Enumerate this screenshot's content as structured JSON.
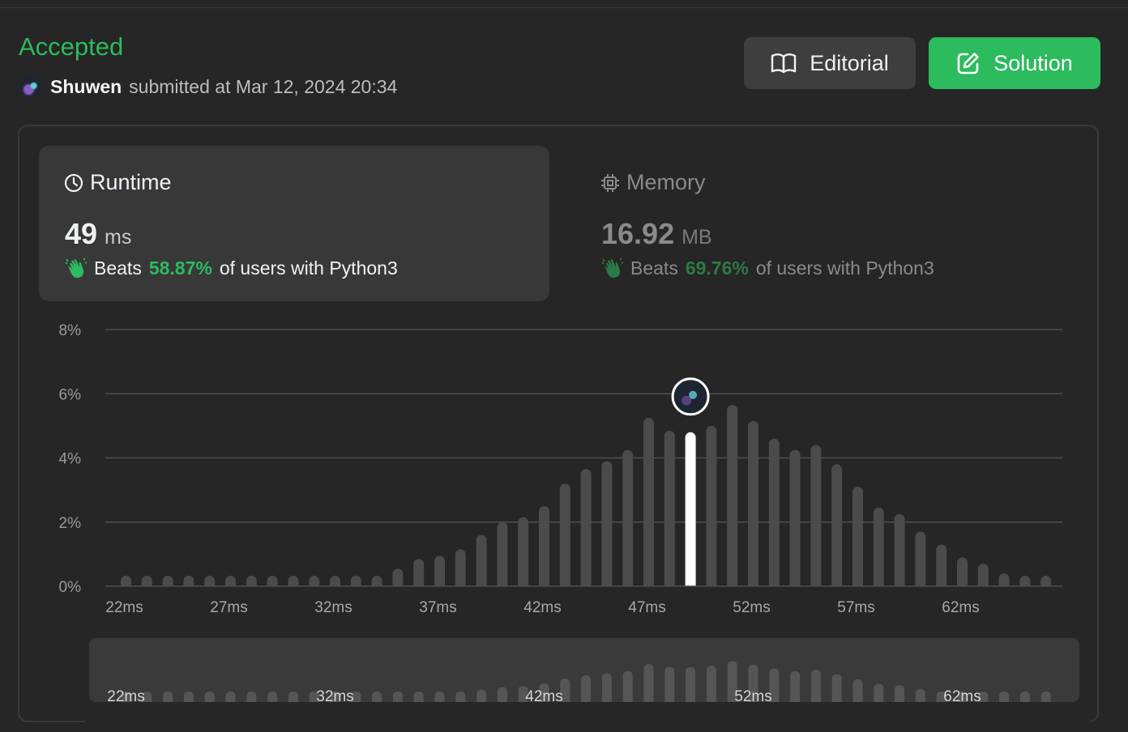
{
  "submission": {
    "status": "Accepted",
    "username": "Shuwen",
    "submitted_text": "submitted at Mar 12, 2024 20:34"
  },
  "buttons": {
    "editorial_label": "Editorial",
    "solution_label": "Solution"
  },
  "runtime": {
    "title": "Runtime",
    "value": "49",
    "unit": "ms",
    "beats_label": "Beats",
    "beats_pct": "58.87%",
    "beats_suffix": "of users with Python3"
  },
  "memory": {
    "title": "Memory",
    "value": "16.92",
    "unit": "MB",
    "beats_label": "Beats",
    "beats_pct": "69.76%",
    "beats_suffix": "of users with Python3"
  },
  "colors": {
    "accent": "#2cbb5d",
    "background": "#262626",
    "card": "#383838",
    "bar": "#4b4b4b",
    "highlight_bar": "#ffffff"
  },
  "chart_data": {
    "type": "bar",
    "x": [
      22,
      23,
      24,
      25,
      26,
      27,
      28,
      29,
      30,
      31,
      32,
      33,
      34,
      35,
      36,
      37,
      38,
      39,
      40,
      41,
      42,
      43,
      44,
      45,
      46,
      47,
      48,
      49,
      50,
      51,
      52,
      53,
      54,
      55,
      56,
      57,
      58,
      59,
      60,
      61,
      62,
      63,
      64,
      65,
      66
    ],
    "values": [
      0.08,
      0.08,
      0.08,
      0.08,
      0.08,
      0.08,
      0.08,
      0.08,
      0.08,
      0.08,
      0.12,
      0.2,
      0.3,
      0.55,
      0.85,
      0.95,
      1.15,
      1.6,
      2.0,
      2.15,
      2.5,
      3.2,
      3.65,
      3.9,
      4.25,
      5.25,
      4.85,
      4.8,
      5.0,
      5.65,
      5.15,
      4.6,
      4.25,
      4.4,
      3.8,
      3.1,
      2.45,
      2.25,
      1.7,
      1.3,
      0.9,
      0.7,
      0.4,
      0.25,
      0.15
    ],
    "highlight_x": 49,
    "yticks": [
      "0%",
      "2%",
      "4%",
      "6%",
      "8%"
    ],
    "ylim": [
      0,
      8
    ],
    "xticks": [
      "22ms",
      "27ms",
      "32ms",
      "37ms",
      "42ms",
      "47ms",
      "52ms",
      "57ms",
      "62ms"
    ],
    "navigator_ticks": [
      "22ms",
      "32ms",
      "42ms",
      "52ms",
      "62ms"
    ],
    "grid": true
  }
}
